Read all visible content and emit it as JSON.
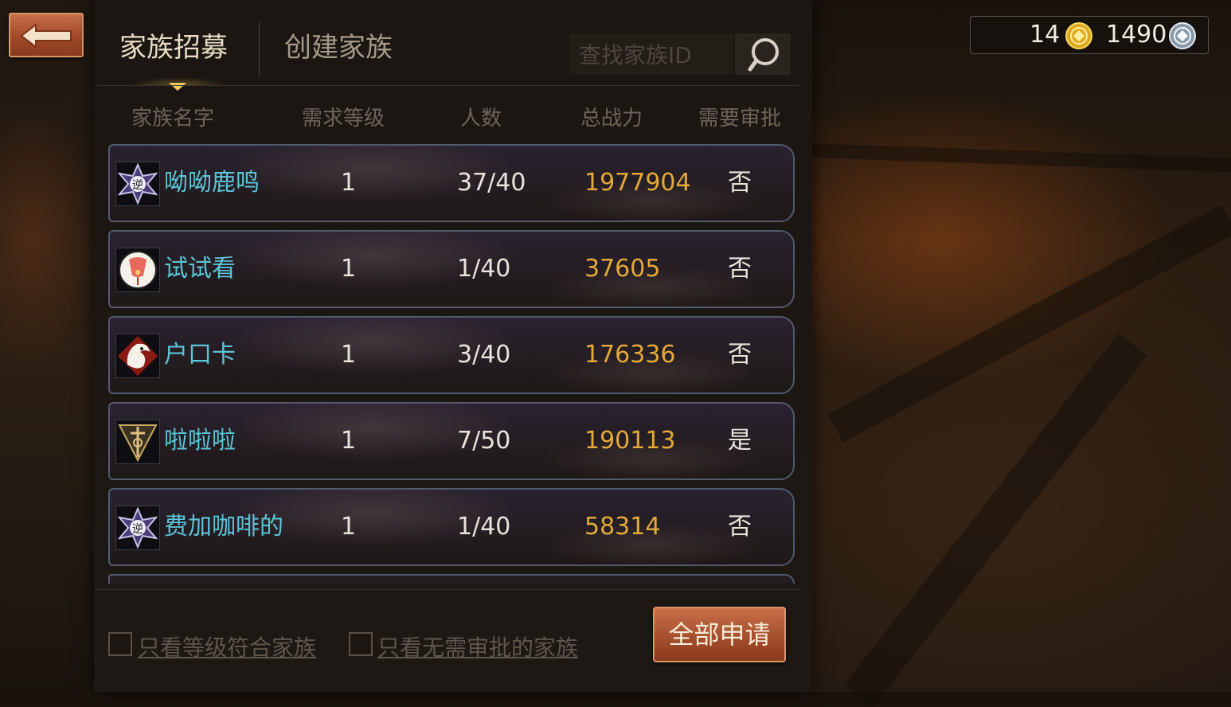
{
  "colors": {
    "accent_button": "#a54e2c",
    "family_name": "#5cc4d8",
    "power_value": "#e3a83a",
    "row_border": "#4f5a6e"
  },
  "nav": {
    "back_icon": "back-arrow-icon"
  },
  "tabs": [
    {
      "label": "家族招募",
      "active": true
    },
    {
      "label": "创建家族",
      "active": false
    }
  ],
  "search": {
    "placeholder": "查找家族ID",
    "value": "",
    "icon": "search-icon"
  },
  "currency": {
    "gold": "14",
    "gold_icon": "gold-coin-icon",
    "silver": "1490",
    "silver_icon": "silver-coin-icon"
  },
  "table": {
    "columns": [
      "家族名字",
      "需求等级",
      "人数",
      "总战力",
      "需要审批"
    ],
    "rows": [
      {
        "emblem": "star-emblem-icon",
        "name": "呦呦鹿鸣",
        "level": "1",
        "members": "37/40",
        "power": "1977904",
        "approval": "否"
      },
      {
        "emblem": "lantern-emblem-icon",
        "name": "试试看",
        "level": "1",
        "members": "1/40",
        "power": "37605",
        "approval": "否"
      },
      {
        "emblem": "dragon-emblem-icon",
        "name": "户口卡",
        "level": "1",
        "members": "3/40",
        "power": "176336",
        "approval": "否"
      },
      {
        "emblem": "sword-emblem-icon",
        "name": "啦啦啦",
        "level": "1",
        "members": "7/50",
        "power": "190113",
        "approval": "是"
      },
      {
        "emblem": "star-emblem-icon",
        "name": "费加咖啡的",
        "level": "1",
        "members": "1/40",
        "power": "58314",
        "approval": "否"
      }
    ]
  },
  "filters": [
    {
      "label": "只看等级符合家族",
      "checked": false
    },
    {
      "label": "只看无需审批的家族",
      "checked": false
    }
  ],
  "apply_all": {
    "label": "全部申请"
  }
}
